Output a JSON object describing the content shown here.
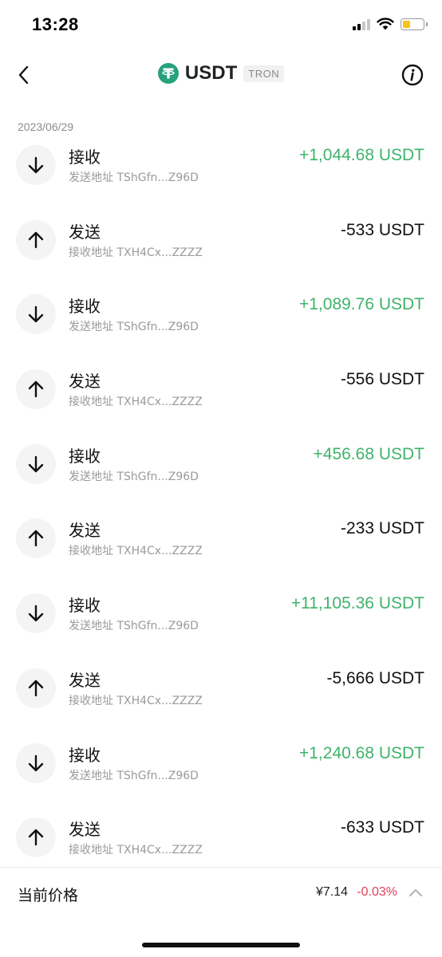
{
  "status_bar": {
    "time": "13:28"
  },
  "nav": {
    "title": "USDT",
    "network": "TRON",
    "logo_color": "#26a17b"
  },
  "date_header": "2023/06/29",
  "transactions": [
    {
      "type": "接收",
      "direction": "in",
      "address_label": "发送地址 TShGfn...Z96D",
      "amount": "+1,044.68 USDT"
    },
    {
      "type": "发送",
      "direction": "out",
      "address_label": "接收地址 TXH4Cx...ZZZZ",
      "amount": "-533 USDT"
    },
    {
      "type": "接收",
      "direction": "in",
      "address_label": "发送地址 TShGfn...Z96D",
      "amount": "+1,089.76 USDT"
    },
    {
      "type": "发送",
      "direction": "out",
      "address_label": "接收地址 TXH4Cx...ZZZZ",
      "amount": "-556 USDT"
    },
    {
      "type": "接收",
      "direction": "in",
      "address_label": "发送地址 TShGfn...Z96D",
      "amount": "+456.68 USDT"
    },
    {
      "type": "发送",
      "direction": "out",
      "address_label": "接收地址 TXH4Cx...ZZZZ",
      "amount": "-233 USDT"
    },
    {
      "type": "接收",
      "direction": "in",
      "address_label": "发送地址 TShGfn...Z96D",
      "amount": "+11,105.36 USDT"
    },
    {
      "type": "发送",
      "direction": "out",
      "address_label": "接收地址 TXH4Cx...ZZZZ",
      "amount": "-5,666 USDT"
    },
    {
      "type": "接收",
      "direction": "in",
      "address_label": "发送地址 TShGfn...Z96D",
      "amount": "+1,240.68 USDT"
    },
    {
      "type": "发送",
      "direction": "out",
      "address_label": "接收地址 TXH4Cx...ZZZZ",
      "amount": "-633 USDT"
    }
  ],
  "price_bar": {
    "label": "当前价格",
    "price": "¥7.14",
    "change": "-0.03%"
  },
  "colors": {
    "incoming": "#3fb36a",
    "outgoing": "#111111",
    "negative_change": "#e0415a",
    "battery": "#f5c518"
  },
  "icons": {
    "incoming": "arrow-down-icon",
    "outgoing": "arrow-up-icon"
  }
}
